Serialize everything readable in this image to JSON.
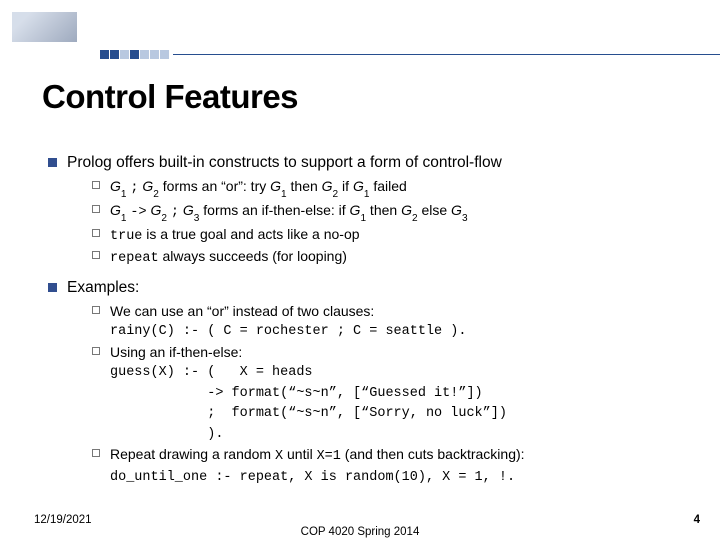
{
  "header": {
    "thumb_alt": "building-thumbnail",
    "title": "Control Features"
  },
  "bullets": [
    {
      "text": "Prolog offers built-in constructs to support a form of control-flow",
      "sub": [
        {
          "html": "<span class='ital'>G</span><sub>1</sub> <span class='code'>;</span> <span class='ital'>G</span><sub>2</sub> forms an “or”: try <span class='ital'>G</span><sub>1</sub> then <span class='ital'>G</span><sub>2</sub> if <span class='ital'>G</span><sub>1</sub> failed"
        },
        {
          "html": "<span class='ital'>G</span><sub>1</sub> <span class='code'>-&gt;</span> <span class='ital'>G</span><sub>2</sub> <span class='code'>;</span> <span class='ital'>G</span><sub>3</sub> forms an if-then-else: if <span class='ital'>G</span><sub>1</sub> then <span class='ital'>G</span><sub>2</sub> else <span class='ital'>G</span><sub>3</sub>"
        },
        {
          "html": "<span class='code'>true</span> is a true goal and acts like a no-op"
        },
        {
          "html": "<span class='code'>repeat</span> always succeeds (for looping)"
        }
      ]
    },
    {
      "text": "Examples:",
      "sub": [
        {
          "html": "We can use an “or” instead of two clauses:<br><span class='code nowrap'>rainy(C) :- ( C = rochester ; C = seattle ).</span>"
        },
        {
          "html": "Using an if-then-else:<br><span class='code'>guess(X) :- (&nbsp;&nbsp; X = heads<br>&nbsp;&nbsp;&nbsp;&nbsp;&nbsp;&nbsp;&nbsp;&nbsp;&nbsp;&nbsp;&nbsp;&nbsp;-&gt; format(“~s~n”, [“Guessed it!”])<br>&nbsp;&nbsp;&nbsp;&nbsp;&nbsp;&nbsp;&nbsp;&nbsp;&nbsp;&nbsp;&nbsp;&nbsp;;&nbsp;&nbsp;format(“~s~n”, [“Sorry, no luck”])<br>&nbsp;&nbsp;&nbsp;&nbsp;&nbsp;&nbsp;&nbsp;&nbsp;&nbsp;&nbsp;&nbsp;&nbsp;).</span>"
        },
        {
          "html": "Repeat drawing a random <span class='code'>X</span> until <span class='code'>X=1</span> (and then cuts backtracking):<br><span class='code nowrap'>do_until_one :- repeat, X is random(10), X = 1, !.</span>"
        }
      ]
    }
  ],
  "footer": {
    "date": "12/19/2021",
    "course": "COP 4020 Spring 2014",
    "page": "4"
  }
}
